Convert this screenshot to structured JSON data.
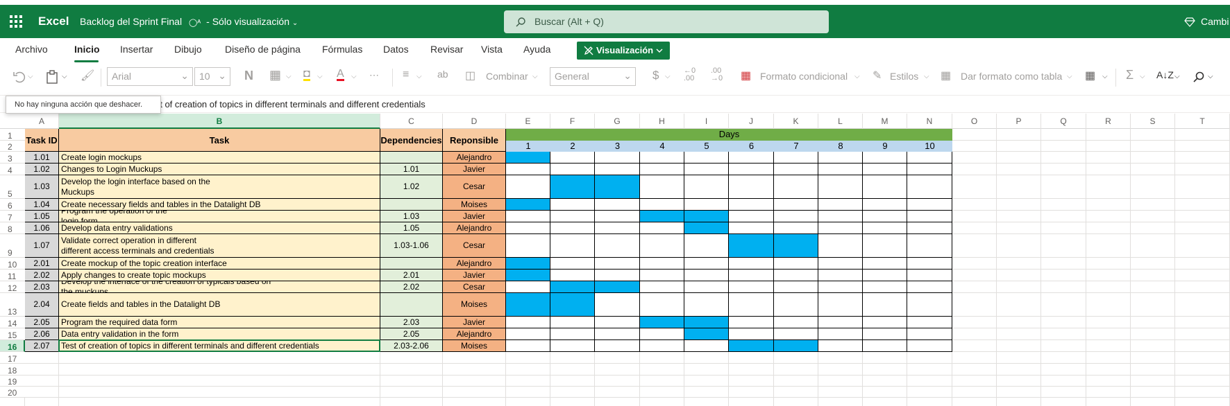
{
  "titlebar": {
    "app_name": "Excel",
    "doc_name": "Backlog del Sprint Final",
    "mode_label": "Sólo visualización",
    "search_placeholder": "Buscar (Alt + Q)",
    "right_label": "Cambi",
    "brand_color": "#107c41"
  },
  "menu": {
    "tabs": [
      "Archivo",
      "Inicio",
      "Insertar",
      "Dibujo",
      "Diseño de página",
      "Fórmulas",
      "Datos",
      "Revisar",
      "Vista",
      "Ayuda"
    ],
    "active_tab": "Inicio",
    "view_button": "Visualización"
  },
  "ribbon": {
    "font_name": "Arial",
    "font_size": "10",
    "bold_label": "N",
    "merge_label": "Combinar",
    "number_format": "General",
    "currency_symbol": "$",
    "conditional_format_label": "Formato condicional",
    "styles_label": "Estilos",
    "format_table_label": "Dar formato como tabla",
    "sum_symbol": "Σ"
  },
  "tooltip": "No hay ninguna acción que deshacer.",
  "formula_bar": "Test of creation of topics in different terminals and different credentials",
  "columns": [
    "A",
    "B",
    "C",
    "D",
    "E",
    "F",
    "G",
    "H",
    "I",
    "J",
    "K",
    "L",
    "M",
    "N",
    "O",
    "P",
    "Q",
    "R",
    "S",
    "T"
  ],
  "selected_column": "B",
  "selected_row": "16",
  "row_numbers": [
    "1",
    "2",
    "3",
    "4",
    "5",
    "6",
    "7",
    "8",
    "9",
    "10",
    "11",
    "12",
    "13",
    "14",
    "15",
    "16",
    "17",
    "18",
    "19",
    "20"
  ],
  "table": {
    "headers": {
      "id": "Task ID",
      "task": "Task",
      "deps": "Dependencies",
      "resp": "Reponsible"
    },
    "days_title": "Days",
    "days": [
      "1",
      "2",
      "3",
      "4",
      "5",
      "6",
      "7",
      "8",
      "9",
      "10"
    ],
    "rows": [
      {
        "id": "1.01",
        "task": "Create login mockups",
        "deps": "",
        "resp": "Alejandro",
        "bars": [
          1
        ]
      },
      {
        "id": "1.02",
        "task": "Changes to Login Muckups",
        "deps": "1.01",
        "resp": "Javier",
        "bars": []
      },
      {
        "id": "1.03",
        "task": "Develop the login interface based on the\nMuckups",
        "deps": "1.02",
        "resp": "Cesar",
        "bars": [
          2,
          3
        ]
      },
      {
        "id": "1.04",
        "task": "Create necessary fields and tables in the Datalight DB",
        "deps": "",
        "resp": "Moises",
        "bars": [
          1
        ]
      },
      {
        "id": "1.05",
        "task": "Program the operation of the\nlogin form",
        "deps": "1.03",
        "resp": "Javier",
        "bars": [
          4,
          5
        ]
      },
      {
        "id": "1.06",
        "task": "Develop data entry validations",
        "deps": "1.05",
        "resp": "Alejandro",
        "bars": [
          5
        ]
      },
      {
        "id": "1.07",
        "task": "Validate correct operation in different\ndifferent access terminals and credentials",
        "deps": "1.03-1.06",
        "resp": "Cesar",
        "bars": [
          6,
          7
        ]
      },
      {
        "id": "2.01",
        "task": "Create mockup of the topic creation interface",
        "deps": "",
        "resp": "Alejandro",
        "bars": [
          1
        ]
      },
      {
        "id": "2.02",
        "task": "Apply changes to create topic mockups",
        "deps": "2.01",
        "resp": "Javier",
        "bars": [
          1
        ]
      },
      {
        "id": "2.03",
        "task": "Develop the interface of the creation of typicals based on\nthe muckups",
        "deps": "2.02",
        "resp": "Cesar",
        "bars": [
          2,
          3
        ]
      },
      {
        "id": "2.04",
        "task": "Create fields and tables in the Datalight DB",
        "deps": "",
        "resp": "Moises",
        "bars": [
          1,
          2
        ]
      },
      {
        "id": "2.05",
        "task": "Program the required data form",
        "deps": "2.03",
        "resp": "Javier",
        "bars": [
          4,
          5
        ]
      },
      {
        "id": "2.06",
        "task": "Data entry validation in the form",
        "deps": "2.05",
        "resp": "Alejandro",
        "bars": [
          5
        ]
      },
      {
        "id": "2.07",
        "task": "Test of creation of topics in different terminals and different credentials",
        "deps": "2.03-2.06",
        "resp": "Moises",
        "bars": [
          6,
          7
        ]
      }
    ],
    "colors": {
      "header": "#f8cba1",
      "id": "#d9d9d9",
      "task": "#fff2cc",
      "deps": "#e2efda",
      "resp": "#f4b183",
      "days_band": "#70ad47",
      "day_numbers": "#bdd7ee",
      "bar": "#00b0f0"
    }
  }
}
